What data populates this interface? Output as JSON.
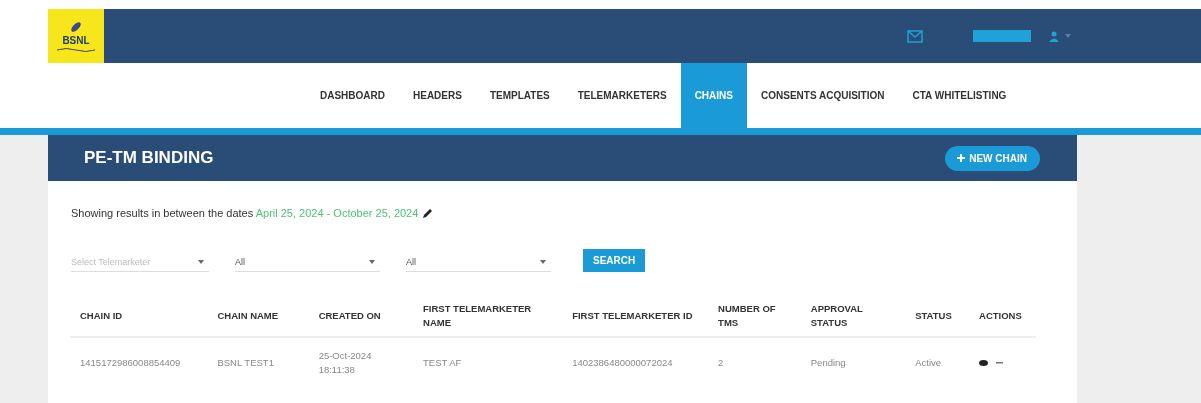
{
  "logo": {
    "text": "BSNL"
  },
  "nav": [
    {
      "label": "DASHBOARD",
      "selected": false
    },
    {
      "label": "HEADERS",
      "selected": false
    },
    {
      "label": "TEMPLATES",
      "selected": false
    },
    {
      "label": "TELEMARKETERS",
      "selected": false
    },
    {
      "label": "CHAINS",
      "selected": true
    },
    {
      "label": "CONSENTS ACQUISITION",
      "selected": false
    },
    {
      "label": "CTA WHITELISTING",
      "selected": false
    }
  ],
  "panel": {
    "title": "PE-TM BINDING",
    "new_button": "NEW CHAIN",
    "date_intro": "Showing results in between the dates",
    "date_range": "April 25, 2024 - October 25, 2024",
    "filters": [
      {
        "placeholder": "Select Telemarketer"
      },
      {
        "value": "All"
      },
      {
        "value": "All"
      }
    ],
    "search_button": "SEARCH"
  },
  "table": {
    "columns": [
      "CHAIN ID",
      "CHAIN NAME",
      "CREATED ON",
      "FIRST TELEMARKETER NAME",
      "FIRST TELEMARKETER ID",
      "NUMBER OF TMS",
      "APPROVAL STATUS",
      "STATUS",
      "ACTIONS"
    ],
    "rows": [
      {
        "cells": [
          "1415172986008854409",
          "BSNL TEST1",
          "25-Oct-2024 18:11:38",
          "TEST AF",
          "1402386480000072024",
          "2",
          "Pending",
          "Active"
        ]
      }
    ]
  }
}
